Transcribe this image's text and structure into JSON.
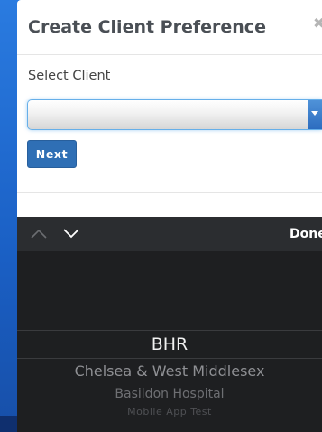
{
  "modal": {
    "title": "Create Client Preference",
    "close_icon": "close-icon",
    "field_label": "Select Client",
    "select_value": "",
    "next_label": "Next"
  },
  "picker": {
    "toolbar": {
      "up_icon": "chevron-up-icon",
      "down_icon": "chevron-down-icon",
      "done_label": "Done"
    },
    "options": [
      {
        "label": "BHR",
        "selected": true
      },
      {
        "label": "Chelsea & West Middlesex",
        "selected": false
      },
      {
        "label": "Basildon Hospital",
        "selected": false
      },
      {
        "label": "Mobile App Test",
        "selected": false
      }
    ]
  },
  "colors": {
    "background_blue": "#1f6fd6",
    "primary_button": "#2f6fb5",
    "picker_background": "#1e1f21",
    "picker_toolbar": "#2b2d30"
  }
}
